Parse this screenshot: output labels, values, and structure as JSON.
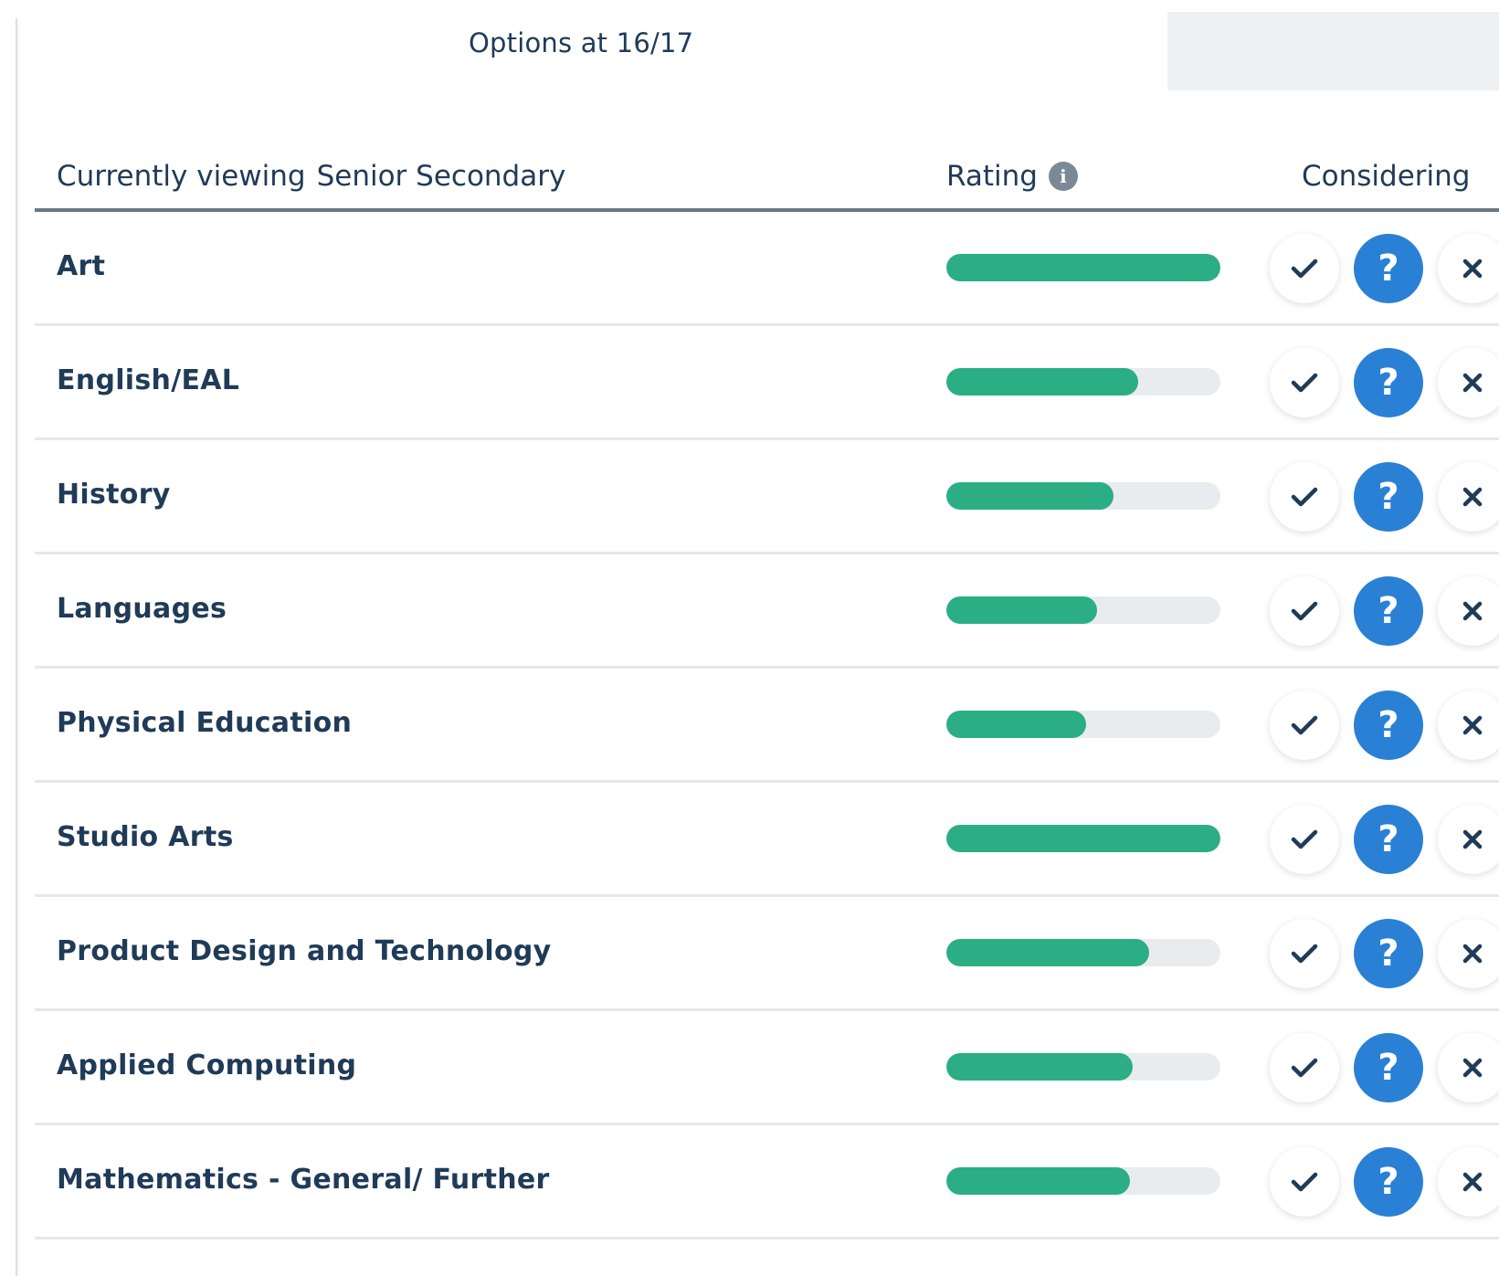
{
  "page_title": "Options at 16/17",
  "header": {
    "viewing_label": "Currently viewing",
    "viewing_scope": "Senior Secondary",
    "rating_label": "Rating",
    "rating_info_icon": "info-icon",
    "considering_label": "Considering"
  },
  "colors": {
    "bar_fill": "#2bae83",
    "bar_track": "#e9ecef",
    "maybe_active": "#2a80d5",
    "text": "#1f3b57"
  },
  "icons": {
    "yes": "checkmark-icon",
    "maybe": "question-icon",
    "no": "close-icon"
  },
  "subjects": [
    {
      "name": "Art",
      "rating": 1.0,
      "considering": "maybe"
    },
    {
      "name": "English/EAL",
      "rating": 0.7,
      "considering": "maybe"
    },
    {
      "name": "History",
      "rating": 0.61,
      "considering": "maybe"
    },
    {
      "name": "Languages",
      "rating": 0.55,
      "considering": "maybe"
    },
    {
      "name": "Physical Education",
      "rating": 0.51,
      "considering": "maybe"
    },
    {
      "name": "Studio Arts",
      "rating": 1.0,
      "considering": "maybe"
    },
    {
      "name": "Product Design and Technology",
      "rating": 0.74,
      "considering": "maybe"
    },
    {
      "name": "Applied Computing",
      "rating": 0.68,
      "considering": "maybe"
    },
    {
      "name": "Mathematics - General/ Further",
      "rating": 0.67,
      "considering": "maybe"
    }
  ]
}
